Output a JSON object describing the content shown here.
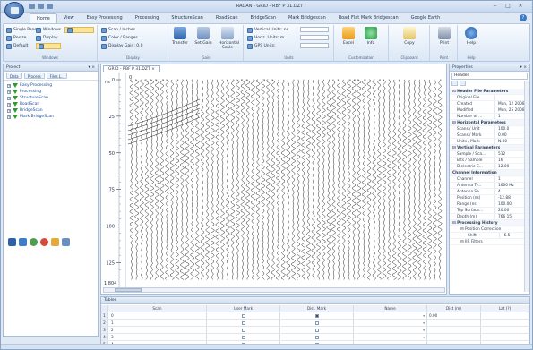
{
  "title_bar": {
    "title": "RADAN - GRID - RBF P 31.DZT"
  },
  "window_controls": {
    "minimize": "–",
    "maximize": "□",
    "close": "✕"
  },
  "ribbon_tabs": [
    {
      "label": "Home",
      "active": true
    },
    {
      "label": "View"
    },
    {
      "label": "Easy Processing"
    },
    {
      "label": "Processing"
    },
    {
      "label": "StructureScan"
    },
    {
      "label": "RoadScan"
    },
    {
      "label": "BridgeScan"
    },
    {
      "label": "Mark Bridgescan"
    },
    {
      "label": "Road Flat Mark Bridgescan"
    },
    {
      "label": "Google Earth"
    }
  ],
  "ribbon": {
    "window_items": [
      "Single Pane",
      "Resize",
      "Default",
      "Windows",
      "Display"
    ],
    "window_label": "Windows",
    "display_items": [
      "Scan / Inches",
      "Color / Ranges",
      "Display Gain: 0.0"
    ],
    "display_label": "Display",
    "big_buttons": [
      "Transfer",
      "Set Gain",
      "Horizontal Scale"
    ],
    "gain_label": "Gain",
    "units_items": [
      "Vertical Units: ns",
      "Horiz. Units: m",
      "GPS Units: "
    ],
    "units_label": "Units",
    "right_buttons": [
      "Excel",
      "Info",
      "Copy",
      "Print",
      "Help"
    ],
    "right_labels": [
      "Customization",
      "Clipboard",
      "Print",
      "Help"
    ]
  },
  "project_panel": {
    "title": "Project",
    "pin": "▾ ×",
    "toolbar": [
      "Data",
      "Process",
      "Files L.."
    ],
    "tree": [
      "Easy Processing",
      "Processing",
      "StructureScan",
      "RoadScan",
      "BridgeScan",
      "Mark BridgeScan"
    ]
  },
  "viewer": {
    "tab": "GRID - RBF P 31.DZT ×",
    "depth_unit": "ns",
    "top_value": "0",
    "y_ticks": [
      "0",
      "25",
      "50",
      "75",
      "100",
      "125"
    ],
    "bottom_label": "1 804"
  },
  "properties": {
    "title": "Properties",
    "selector": "Header",
    "rows": [
      {
        "type": "cat",
        "k": "⊟ Header File Parameters"
      },
      {
        "k": "Original File",
        "v": ""
      },
      {
        "k": "Created",
        "v": "Mon, 12 2008..."
      },
      {
        "k": "Modified",
        "v": "Mon, 25 2008..."
      },
      {
        "k": "Number of ...",
        "v": "1"
      },
      {
        "type": "cat",
        "k": "⊟ Horizontal Parameters"
      },
      {
        "k": "Scans / Unit",
        "v": "100.0"
      },
      {
        "k": "Scans / Mark",
        "v": "0.00"
      },
      {
        "k": "Units / Mark",
        "v": "N.00"
      },
      {
        "type": "cat",
        "k": "⊟ Vertical Parameters"
      },
      {
        "k": "Sample / Sca...",
        "v": "512"
      },
      {
        "k": "Bits / Sample",
        "v": "16"
      },
      {
        "k": "Dielectric C...",
        "v": "12.00"
      },
      {
        "type": "cat",
        "k": "Channel Information"
      },
      {
        "k": "Channel",
        "v": "1"
      },
      {
        "k": "Antenna Ty...",
        "v": "1600 Hz"
      },
      {
        "k": "Antenna Se...",
        "v": "4"
      },
      {
        "k": "Position (ns)",
        "v": "-12.88"
      },
      {
        "k": "Range (ns)",
        "v": "100.00"
      },
      {
        "k": "Top Surface...",
        "v": "20.00"
      },
      {
        "k": "Depth (m)",
        "v": "766 15"
      },
      {
        "type": "cat",
        "k": "⊟ Processing History"
      },
      {
        "type": "sub",
        "k": "⊟ Position Correction"
      },
      {
        "type": "sub2",
        "k": "Shift",
        "v": "-6.5"
      },
      {
        "type": "sub",
        "k": "⊟ IIR Filters"
      }
    ]
  },
  "table_panel": {
    "title": "Tables",
    "headers": [
      "Scan",
      "User Mark",
      "Dist. Mark",
      "Name",
      "Dist (m)",
      "Lat (?)"
    ],
    "rows": [
      {
        "idx": "1",
        "scan": "0",
        "user": false,
        "dist": true,
        "name": "",
        "distm": "0.00"
      },
      {
        "idx": "2",
        "scan": "1",
        "user": false,
        "dist": false,
        "name": "",
        "distm": ""
      },
      {
        "idx": "3",
        "scan": "2",
        "user": false,
        "dist": false,
        "name": "",
        "distm": ""
      },
      {
        "idx": "4",
        "scan": "3",
        "user": false,
        "dist": false,
        "name": "",
        "distm": ""
      },
      {
        "idx": "5",
        "scan": "4",
        "user": false,
        "dist": false,
        "name": "",
        "distm": ""
      }
    ]
  },
  "colors": {
    "accent": "#3d78c6",
    "highlight": "#fbe39a",
    "tree_icon": "#2f9b2f"
  }
}
